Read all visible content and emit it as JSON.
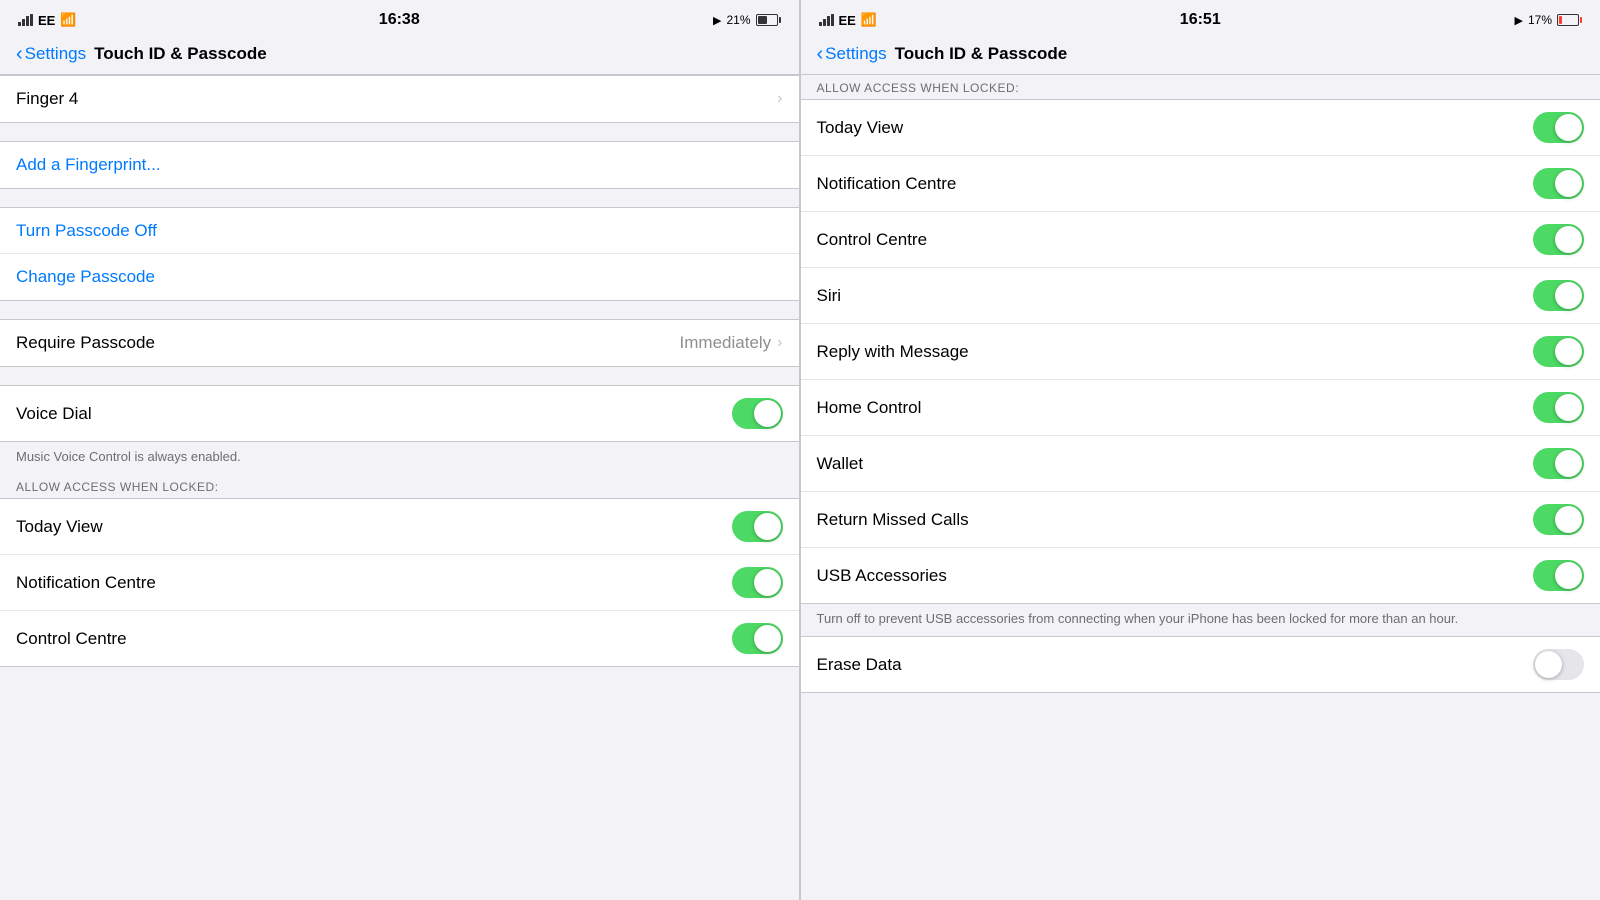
{
  "left_panel": {
    "status_bar": {
      "signal": "EE",
      "time": "16:38",
      "location": true,
      "battery_percent": "21%",
      "battery_low": false
    },
    "nav": {
      "back_label": "Settings",
      "title": "Touch ID & Passcode"
    },
    "sections": [
      {
        "id": "fingerprints",
        "items": [
          {
            "label": "Finger 4",
            "type": "nav",
            "value": ""
          }
        ]
      },
      {
        "id": "add-fingerprint",
        "items": [
          {
            "label": "Add a Fingerprint...",
            "type": "blue",
            "value": ""
          }
        ]
      },
      {
        "id": "spacer1",
        "type": "spacer"
      },
      {
        "id": "passcode-options",
        "items": [
          {
            "label": "Turn Passcode Off",
            "type": "blue"
          },
          {
            "label": "Change Passcode",
            "type": "blue"
          }
        ]
      },
      {
        "id": "spacer2",
        "type": "spacer"
      },
      {
        "id": "require-passcode",
        "items": [
          {
            "label": "Require Passcode",
            "type": "nav",
            "value": "Immediately"
          }
        ]
      },
      {
        "id": "spacer3",
        "type": "spacer"
      },
      {
        "id": "voice-dial",
        "items": [
          {
            "label": "Voice Dial",
            "type": "toggle",
            "on": true
          }
        ]
      },
      {
        "id": "footer-voice",
        "type": "footer",
        "text": "Music Voice Control is always enabled."
      },
      {
        "id": "section-header-locked",
        "type": "section-header",
        "text": "ALLOW ACCESS WHEN LOCKED:"
      },
      {
        "id": "locked-items",
        "items": [
          {
            "label": "Today View",
            "type": "toggle",
            "on": true
          },
          {
            "label": "Notification Centre",
            "type": "toggle",
            "on": true
          },
          {
            "label": "Control Centre",
            "type": "toggle",
            "on": true
          }
        ]
      }
    ]
  },
  "right_panel": {
    "status_bar": {
      "signal": "EE",
      "time": "16:51",
      "location": true,
      "battery_percent": "17%",
      "battery_low": true
    },
    "nav": {
      "back_label": "Settings",
      "title": "Touch ID & Passcode"
    },
    "section_header": "ALLOW ACCESS WHEN LOCKED:",
    "items": [
      {
        "label": "Today View",
        "type": "toggle",
        "on": true
      },
      {
        "label": "Notification Centre",
        "type": "toggle",
        "on": true
      },
      {
        "label": "Control Centre",
        "type": "toggle",
        "on": true
      },
      {
        "label": "Siri",
        "type": "toggle",
        "on": true
      },
      {
        "label": "Reply with Message",
        "type": "toggle",
        "on": true
      },
      {
        "label": "Home Control",
        "type": "toggle",
        "on": true
      },
      {
        "label": "Wallet",
        "type": "toggle",
        "on": true
      },
      {
        "label": "Return Missed Calls",
        "type": "toggle",
        "on": true
      },
      {
        "label": "USB Accessories",
        "type": "toggle",
        "on": true
      }
    ],
    "usb_footer": "Turn off to prevent USB accessories from connecting when your iPhone has been locked for more than an hour.",
    "bottom_item": {
      "label": "Erase Data",
      "type": "toggle",
      "on": false
    }
  }
}
